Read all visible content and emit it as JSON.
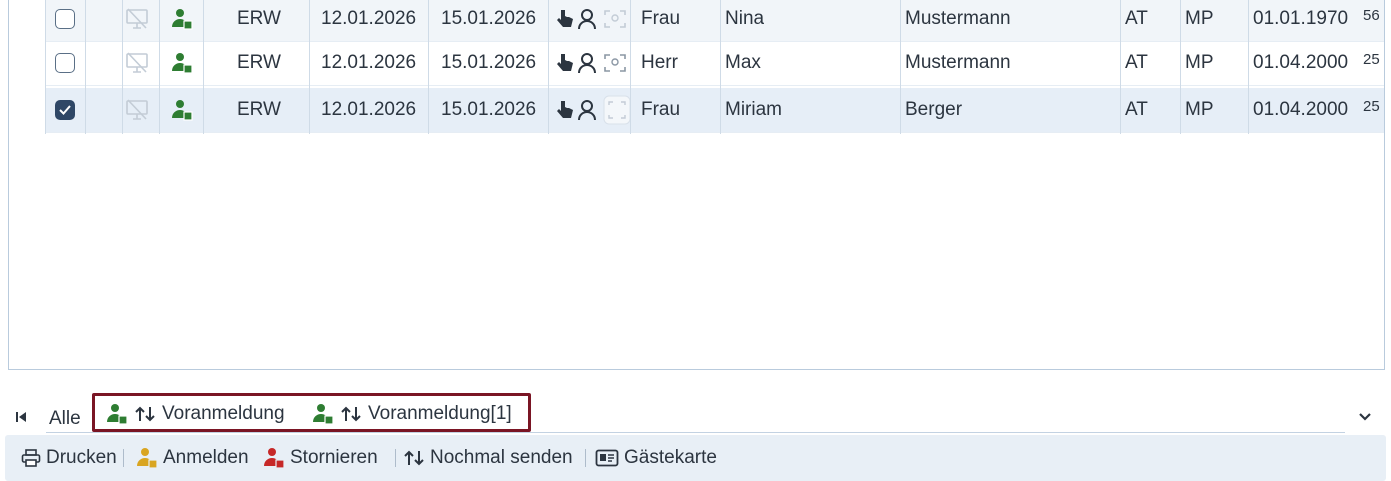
{
  "grid": {
    "rows": [
      {
        "selected": false,
        "type": "ERW",
        "arrival": "12.01.2026",
        "departure": "15.01.2026",
        "salutation": "Frau",
        "first_name": "Nina",
        "last_name": "Mustermann",
        "country": "AT",
        "category": "MP",
        "birthdate": "01.01.1970",
        "age": "56"
      },
      {
        "selected": false,
        "type": "ERW",
        "arrival": "12.01.2026",
        "departure": "15.01.2026",
        "salutation": "Herr",
        "first_name": "Max",
        "last_name": "Mustermann",
        "country": "AT",
        "category": "MP",
        "birthdate": "01.04.2000",
        "age": "25"
      },
      {
        "selected": true,
        "type": "ERW",
        "arrival": "12.01.2026",
        "departure": "15.01.2026",
        "salutation": "Frau",
        "first_name": "Miriam",
        "last_name": "Berger",
        "country": "AT",
        "category": "MP",
        "birthdate": "01.04.2000",
        "age": "25"
      }
    ]
  },
  "tabs": {
    "all_label": "Alle",
    "items": [
      {
        "label": "Voranmeldung"
      },
      {
        "label": "Voranmeldung[1]"
      }
    ]
  },
  "toolbar": {
    "print_label": "Drucken",
    "register_label": "Anmelden",
    "cancel_label": "Stornieren",
    "resend_label": "Nochmal senden",
    "guestcard_label": "Gästekarte"
  },
  "colors": {
    "person_green": "#2e7d32",
    "person_yellow": "#d9a521",
    "person_red": "#c62828",
    "highlight": "#7a1524",
    "checkbox_selected": "#2f4766"
  },
  "icons": [
    "first-page-icon",
    "chevron-down-icon",
    "printer-icon",
    "person-icon",
    "arrows-up-down-icon",
    "id-card-icon",
    "hand-pointer-icon",
    "monitor-off-icon",
    "scan-icon"
  ]
}
